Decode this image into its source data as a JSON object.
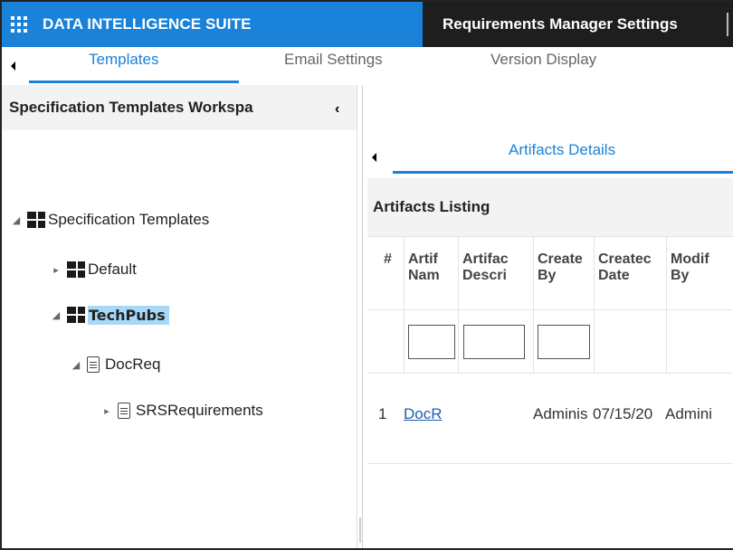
{
  "header": {
    "brand_title": "DATA INTELLIGENCE SUITE",
    "module_title": "Requirements Manager Settings",
    "brand_color": "#1a82d9",
    "module_bg": "#1e1e1e"
  },
  "tabs": [
    {
      "label": "Templates",
      "active": true
    },
    {
      "label": "Email Settings",
      "active": false
    },
    {
      "label": "Version Display",
      "active": false
    }
  ],
  "left_panel": {
    "title": "Specification Templates Workspa",
    "collapse_glyph": "‹"
  },
  "tree": {
    "root": {
      "label": "Specification Templates",
      "toggle": "◢"
    },
    "default": {
      "label": "Default",
      "toggle": "▸"
    },
    "techpubs": {
      "label": "TechPubs",
      "toggle": "◢",
      "selected": true
    },
    "docreq": {
      "label": "DocReq",
      "toggle": "◢"
    },
    "srs": {
      "label": "SRSRequirements",
      "toggle": "▸"
    }
  },
  "right_panel": {
    "tab_label": "Artifacts Details",
    "listing_title": "Artifacts Listing",
    "columns": [
      {
        "line1": "#",
        "line2": ""
      },
      {
        "line1": "Artif",
        "line2": "Nam"
      },
      {
        "line1": "Artifac",
        "line2": "Descri"
      },
      {
        "line1": "Create",
        "line2": "By"
      },
      {
        "line1": "Createc",
        "line2": "Date"
      },
      {
        "line1": "Modif",
        "line2": "By"
      }
    ],
    "filter_values": [
      "",
      "",
      ""
    ],
    "row": {
      "num": "1",
      "name": "DocR",
      "description": "",
      "created_by": "Adminis",
      "created_date": "07/15/20",
      "modified_by": "Admini"
    }
  }
}
